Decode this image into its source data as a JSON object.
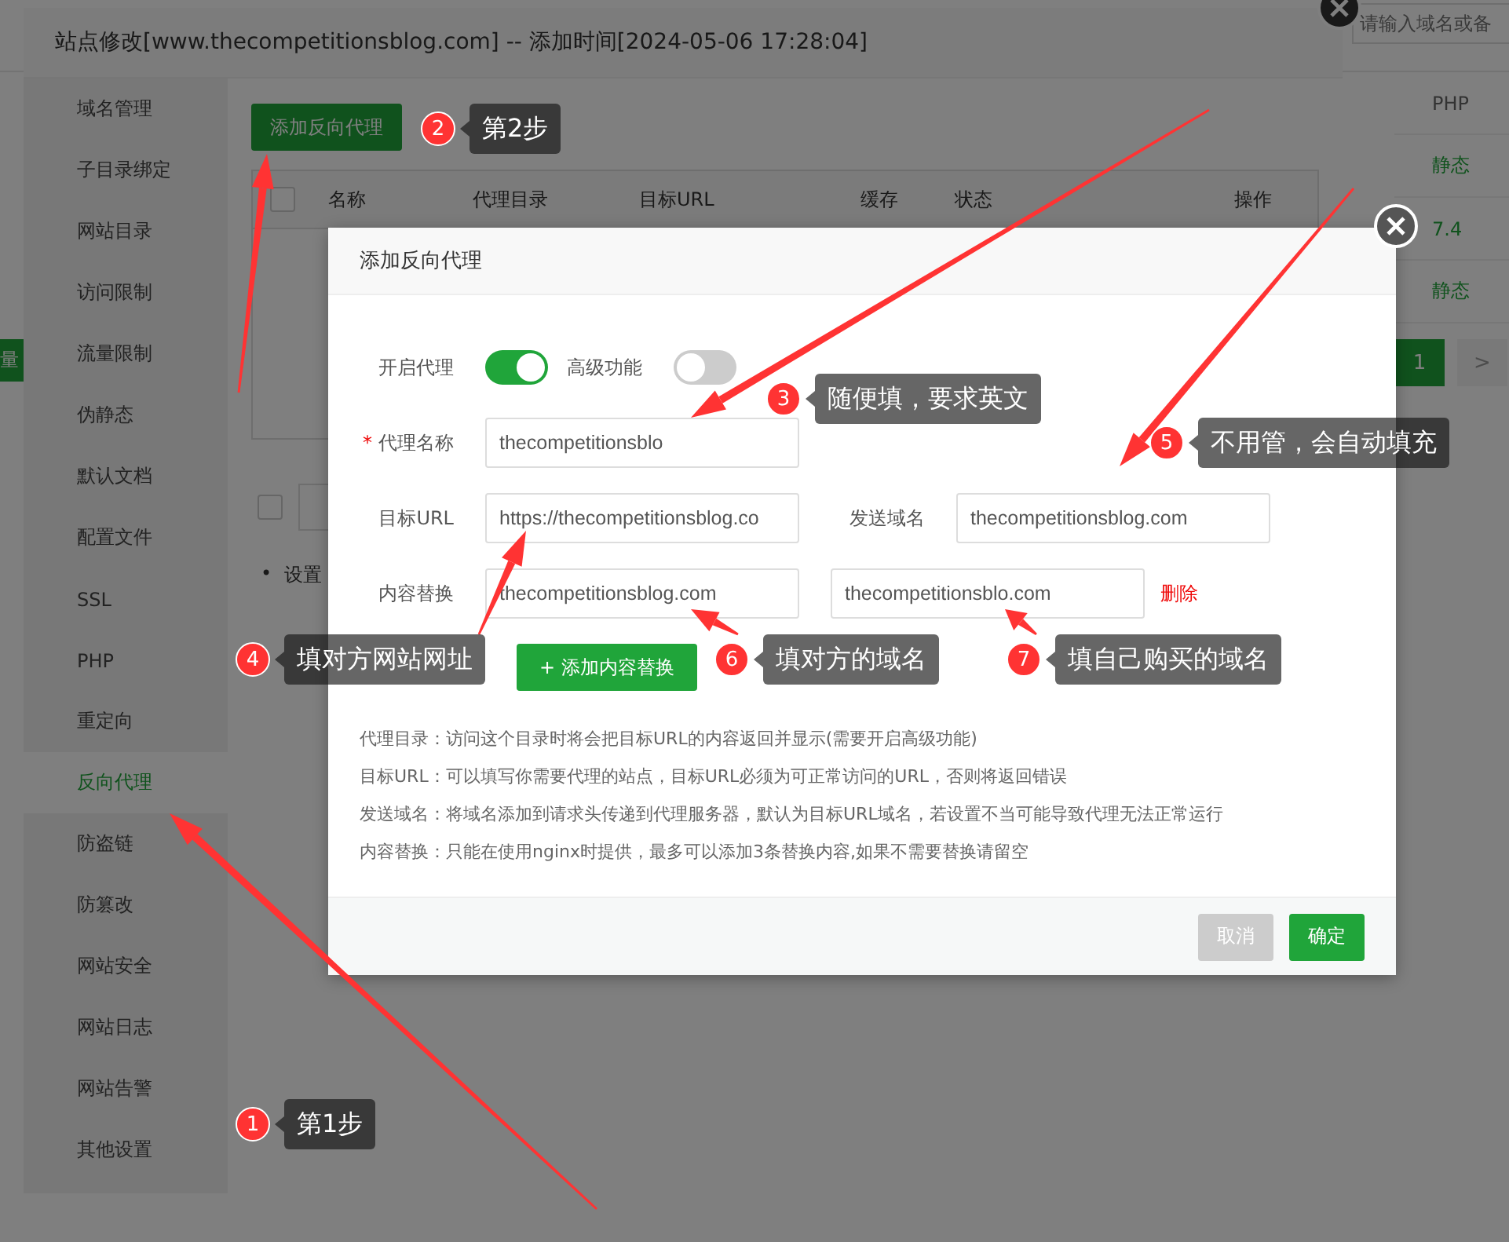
{
  "background_page": {
    "search": {
      "placeholder": "请输入域名或备"
    },
    "batch_button": "量",
    "php_column": {
      "heading": "PHP",
      "cells": [
        "静态",
        "7.4",
        "静态"
      ]
    },
    "pagination": [
      {
        "label": "1",
        "selected": true
      },
      {
        "label": ">",
        "selected": false
      }
    ]
  },
  "site_dialog": {
    "title": "站点修改[www.thecompetitionsblog.com] -- 添加时间[2024-05-06 17:28:04]",
    "menu": [
      {
        "label": "域名管理",
        "selected": false
      },
      {
        "label": "子目录绑定",
        "selected": false
      },
      {
        "label": "网站目录",
        "selected": false
      },
      {
        "label": "访问限制",
        "selected": false
      },
      {
        "label": "流量限制",
        "selected": false
      },
      {
        "label": "伪静态",
        "selected": false
      },
      {
        "label": "默认文档",
        "selected": false
      },
      {
        "label": "配置文件",
        "selected": false
      },
      {
        "label": "SSL",
        "selected": false
      },
      {
        "label": "PHP",
        "selected": false
      },
      {
        "label": "重定向",
        "selected": false
      },
      {
        "label": "反向代理",
        "selected": true
      },
      {
        "label": "防盗链",
        "selected": false
      },
      {
        "label": "防篡改",
        "selected": false
      },
      {
        "label": "网站安全",
        "selected": false
      },
      {
        "label": "网站日志",
        "selected": false
      },
      {
        "label": "网站告警",
        "selected": false
      },
      {
        "label": "其他设置",
        "selected": false
      }
    ],
    "add_button": "添加反向代理",
    "select_all": {
      "checked": false
    },
    "table_columns": [
      "名称",
      "代理目录",
      "目标URL",
      "缓存",
      "状态",
      "操作"
    ],
    "batch_select": {
      "checked": false
    },
    "note": {
      "bullet": "•",
      "text": "设置"
    }
  },
  "proxy_dialog": {
    "title": "添加反向代理",
    "toggles": [
      {
        "label": "开启代理",
        "on": true
      },
      {
        "label": "高级功能",
        "on": false
      }
    ],
    "name_field": {
      "label": "代理名称",
      "required_mark": "*",
      "value": "thecompetitionsblo"
    },
    "target_field": {
      "label": "目标URL",
      "value": "https://thecompetitionsblog.co"
    },
    "send_domain_field": {
      "label": "发送域名",
      "value": "thecompetitionsblog.com"
    },
    "replace": {
      "label": "内容替换",
      "from": "thecompetitionsblog.com",
      "to": "thecompetitionsblo.com",
      "delete_link": "删除"
    },
    "add_replace_button": {
      "icon": "+",
      "label": "添加内容替换"
    },
    "notes": [
      "代理目录：访问这个目录时将会把目标URL的内容返回并显示(需要开启高级功能)",
      "目标URL：可以填写你需要代理的站点，目标URL必须为可正常访问的URL，否则将返回错误",
      "发送域名：将域名添加到请求头传递到代理服务器，默认为目标URL域名，若设置不当可能导致代理无法正常运行",
      "内容替换：只能在使用nginx时提供，最多可以添加3条替换内容,如果不需要替换请留空"
    ],
    "buttons": [
      {
        "label": "取消",
        "kind": "cancel"
      },
      {
        "label": "确定",
        "kind": "confirm"
      }
    ]
  },
  "annotations": [
    {
      "number": "1",
      "text": "第1步"
    },
    {
      "number": "2",
      "text": "第2步"
    },
    {
      "number": "3",
      "text": "随便填，要求英文"
    },
    {
      "number": "4",
      "text": "填对方网站网址"
    },
    {
      "number": "5",
      "text": "不用管，会自动填充"
    },
    {
      "number": "6",
      "text": "填对方的域名"
    },
    {
      "number": "7",
      "text": "填自己购买的域名"
    }
  ]
}
